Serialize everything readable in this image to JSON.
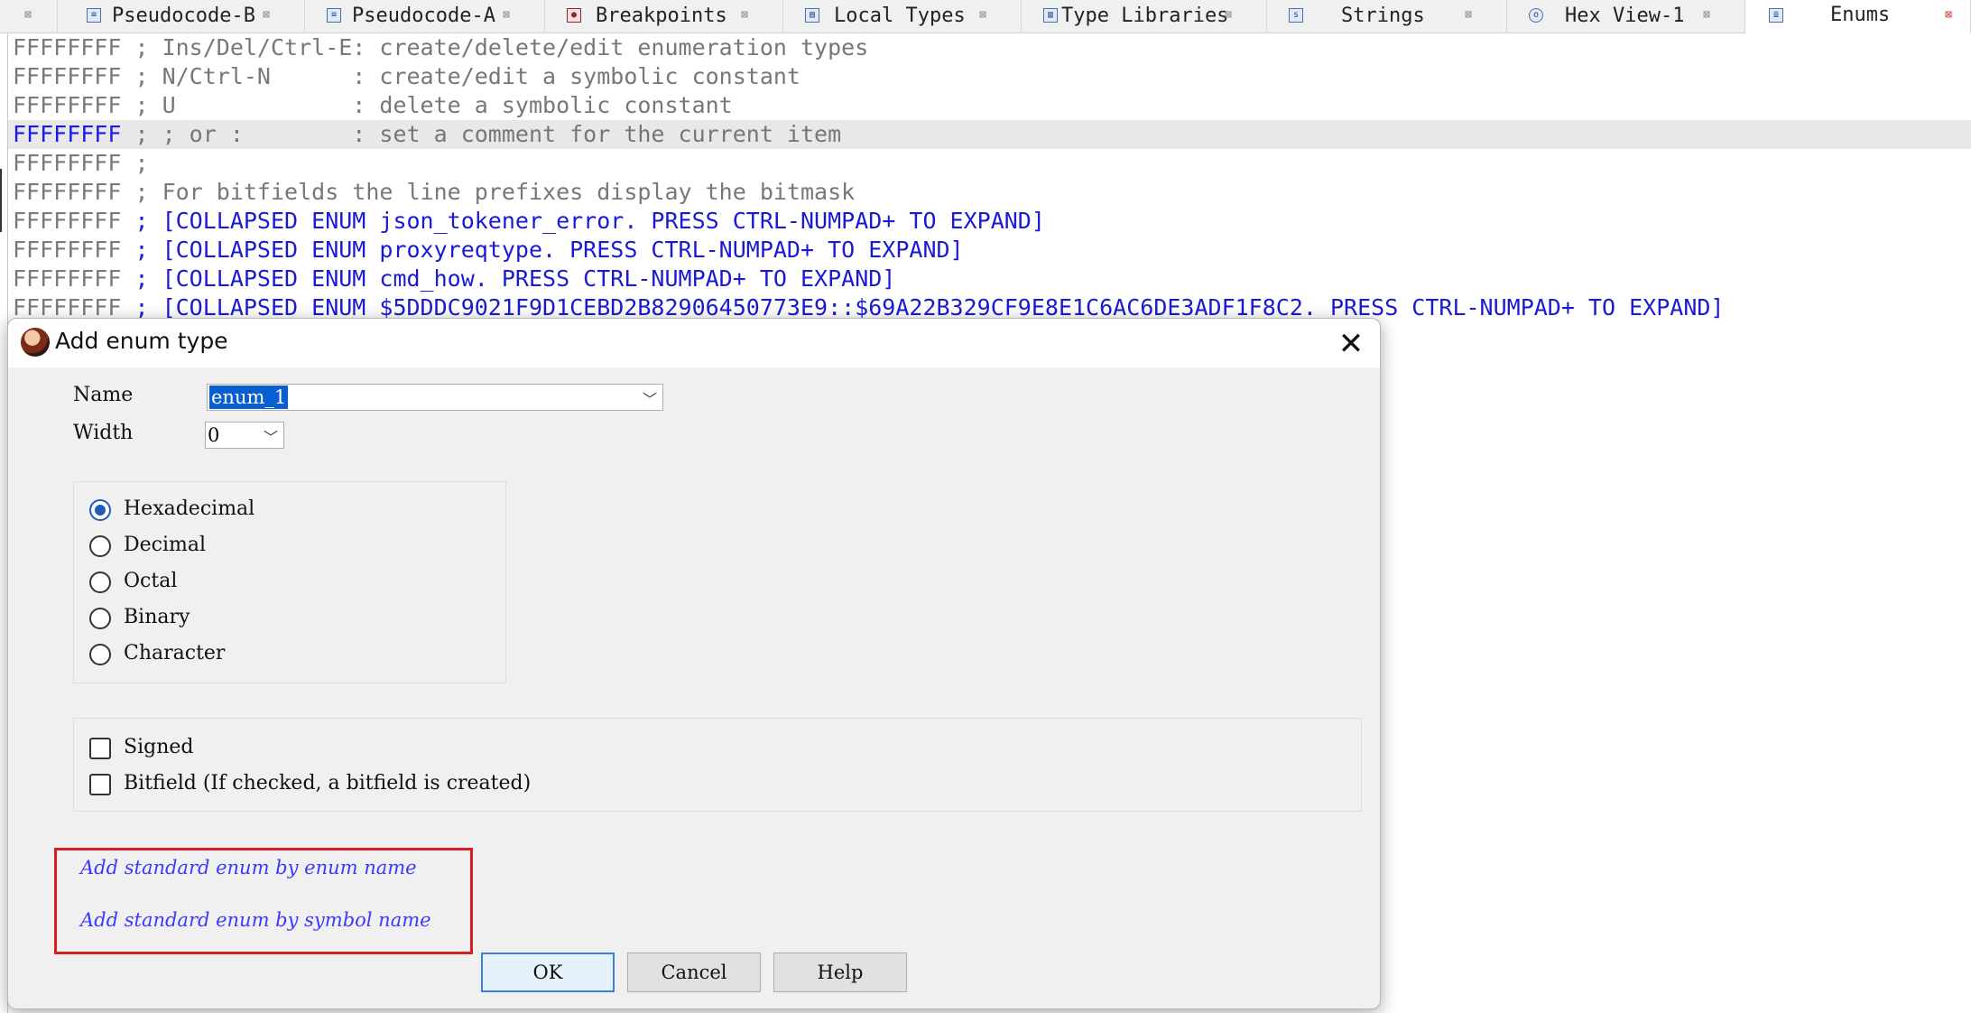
{
  "tabs": [
    {
      "label": "",
      "icon": "close-icon"
    },
    {
      "label": "Pseudocode-B",
      "icon": "pseudocode-icon"
    },
    {
      "label": "Pseudocode-A",
      "icon": "pseudocode-icon"
    },
    {
      "label": "Breakpoints",
      "icon": "breakpoints-icon"
    },
    {
      "label": "Local Types",
      "icon": "local-types-icon"
    },
    {
      "label": "Type Libraries",
      "icon": "type-libraries-icon"
    },
    {
      "label": "Strings",
      "icon": "strings-icon"
    },
    {
      "label": "Hex View-1",
      "icon": "hex-view-icon"
    },
    {
      "label": "Enums",
      "icon": "enums-icon",
      "active": true
    }
  ],
  "listing": {
    "lines": [
      {
        "addr": "FFFFFFFF",
        "text": " ; Ins/Del/Ctrl-E: create/delete/edit enumeration types"
      },
      {
        "addr": "FFFFFFFF",
        "text": " ; N/Ctrl-N      : create/edit a symbolic constant"
      },
      {
        "addr": "FFFFFFFF",
        "text": " ; U             : delete a symbolic constant"
      },
      {
        "addr": "FFFFFFFF",
        "text": " ; ; or :        : set a comment for the current item"
      },
      {
        "addr": "FFFFFFFF",
        "text": " ;"
      },
      {
        "addr": "FFFFFFFF",
        "text": " ; For bitfields the line prefixes display the bitmask"
      },
      {
        "addr": "FFFFFFFF",
        "text": " ; [COLLAPSED ENUM json_tokener_error. PRESS CTRL-NUMPAD+ TO EXPAND]"
      },
      {
        "addr": "FFFFFFFF",
        "text": " ; [COLLAPSED ENUM proxyreqtype. PRESS CTRL-NUMPAD+ TO EXPAND]"
      },
      {
        "addr": "FFFFFFFF",
        "text": " ; [COLLAPSED ENUM cmd_how. PRESS CTRL-NUMPAD+ TO EXPAND]"
      },
      {
        "addr": "FFFFFFFF",
        "text": " ; [COLLAPSED ENUM $5DDDC9021F9D1CEBD2B82906450773E9::$69A22B329CF9E8E1C6AC6DE3ADF1F8C2. PRESS CTRL-NUMPAD+ TO EXPAND]"
      }
    ]
  },
  "dialog": {
    "title": "Add enum type",
    "name_label": "Name",
    "name_value": "enum_1",
    "width_label": "Width",
    "width_value": "0",
    "radix_options": [
      "Hexadecimal",
      "Decimal",
      "Octal",
      "Binary",
      "Character"
    ],
    "radix_selected": "Hexadecimal",
    "signed_label": "Signed",
    "bitfield_label": "Bitfield (If checked, a bitfield is created)",
    "link_enum_name": "Add standard enum by enum name",
    "link_symbol_name": "Add standard enum by symbol name",
    "ok_label": "OK",
    "cancel_label": "Cancel",
    "help_label": "Help"
  },
  "colors": {
    "highlight_addr": "#1a1af0",
    "collapsed_text": "#1a1ad6",
    "link": "#3a3aff",
    "annotation_box": "#d62020",
    "radio_selected": "#1f5bbf"
  }
}
